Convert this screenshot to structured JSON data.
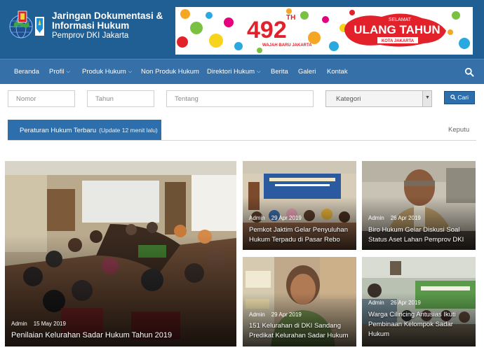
{
  "site": {
    "title_line1": "Jaringan Dokumentasi &",
    "title_line2": "Informasi Hukum",
    "title_line3": "Pemprov DKI Jakarta",
    "logo_icon": "jdih-globe-emblem-icon"
  },
  "banner": {
    "number": "492",
    "superscript": "TH",
    "tagline_small": "WAJAH BARU JAKARTA",
    "greeting_top": "SELAMAT",
    "greeting_main": "ULANG TAHUN",
    "greeting_bottom": "KOTA JAKARTA",
    "accent_color": "#e2212b"
  },
  "nav": {
    "items": [
      {
        "label": "Beranda",
        "dropdown": false
      },
      {
        "label": "Profil",
        "dropdown": true
      },
      {
        "label": "Produk Hukum",
        "dropdown": true
      },
      {
        "label": "Non Produk Hukum",
        "dropdown": false
      },
      {
        "label": "Direktori Hukum",
        "dropdown": true
      },
      {
        "label": "Berita",
        "dropdown": false
      },
      {
        "label": "Galeri",
        "dropdown": false
      },
      {
        "label": "Kontak",
        "dropdown": false
      }
    ],
    "search_icon": "search-icon",
    "background": "#3570a8"
  },
  "search": {
    "nomor_placeholder": "Nomor",
    "tahun_placeholder": "Tahun",
    "tentang_placeholder": "Tentang",
    "kategori_selected": "Kategori",
    "button_label": "Cari"
  },
  "ticker": {
    "label": "Peraturan Hukum Terbaru",
    "sublabel": "(Update 12 menit lalu)",
    "scrolling_text": "Keputu"
  },
  "news": [
    {
      "author": "Admin",
      "date": "15 May 2019",
      "title": "Penilaian Kelurahan Sadar Hukum Tahun 2019"
    },
    {
      "author": "Admin",
      "date": "29 Apr 2019",
      "title": "Pemkot Jaktim Gelar Penyuluhan Hukum Terpadu di Pasar Rebo"
    },
    {
      "author": "Admin",
      "date": "26 Apr 2019",
      "title": "Biro Hukum Gelar Diskusi Soal Status Aset Lahan Pemprov DKI"
    },
    {
      "author": "Admin",
      "date": "29 Apr 2019",
      "title": "151 Kelurahan di DKI Sandang Predikat Kelurahan Sadar Hukum"
    },
    {
      "author": "Admin",
      "date": "26 Apr 2019",
      "title": "Warga Cilincing Antusias Ikuti Pembinaan Kelompok Sadar Hukum"
    }
  ]
}
